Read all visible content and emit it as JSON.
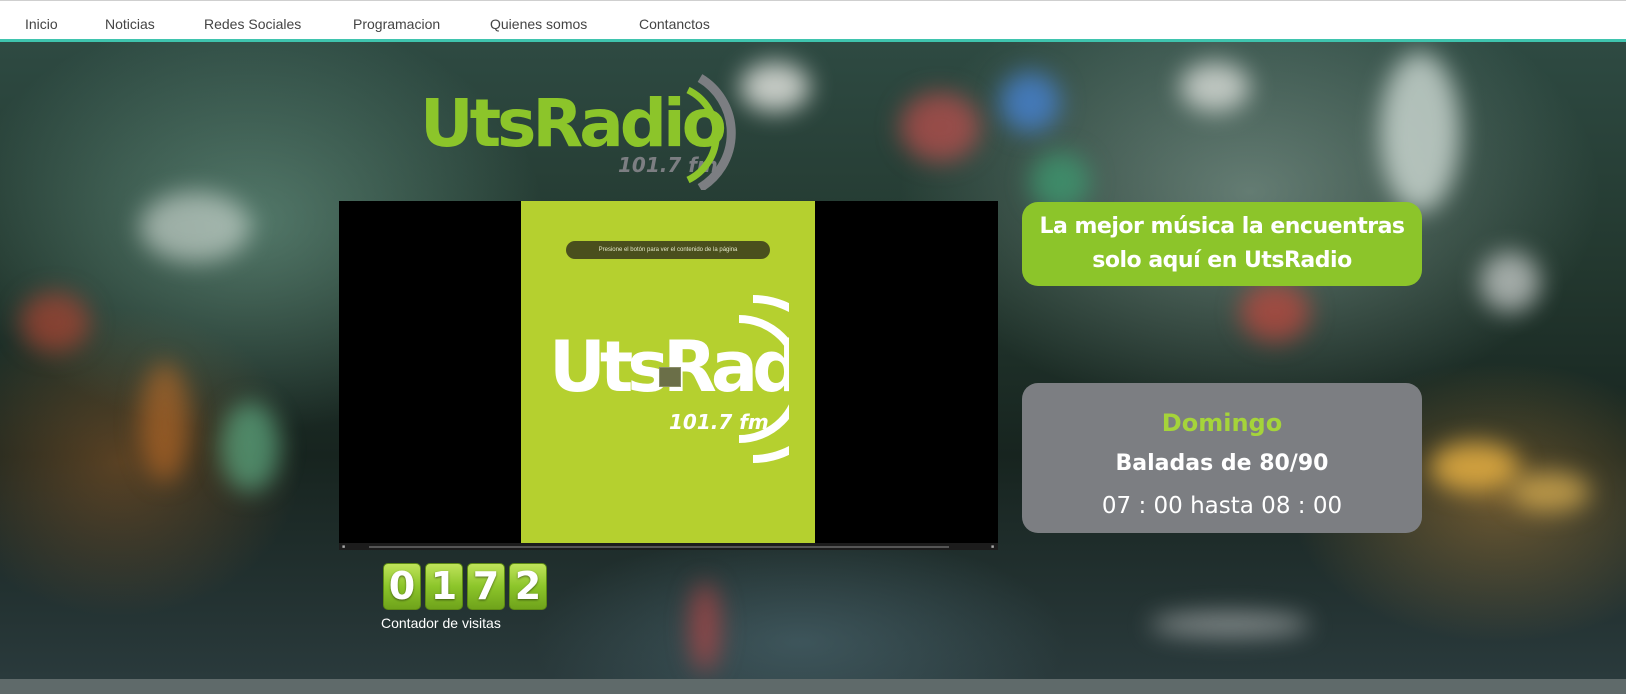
{
  "nav": {
    "items": [
      {
        "label": "Inicio"
      },
      {
        "label": "Noticias"
      },
      {
        "label": "Redes Sociales"
      },
      {
        "label": "Programacion"
      },
      {
        "label": "Quienes somos"
      },
      {
        "label": "Contanctos"
      }
    ]
  },
  "logo": {
    "brand": "UtsRadio",
    "frequency": "101.7 fm",
    "colors": {
      "green": "#8cc52a",
      "gray": "#7c7e82"
    }
  },
  "player": {
    "notice": "Presione el botón para ver el contenido de la página",
    "poster_brand": "UtsRadio",
    "poster_frequency": "101.7 fm",
    "poster_color": "#b5d02f",
    "play_icon": "play-icon"
  },
  "slogan": {
    "line1": "La mejor música la encuentras",
    "line2": "solo aquí en UtsRadio"
  },
  "schedule": {
    "day": "Domingo",
    "show": "Baladas de 80/90",
    "time": "07 : 00 hasta 08 : 00"
  },
  "visits": {
    "digits": [
      "0",
      "1",
      "7",
      "2"
    ],
    "label": "Contador de visitas"
  }
}
